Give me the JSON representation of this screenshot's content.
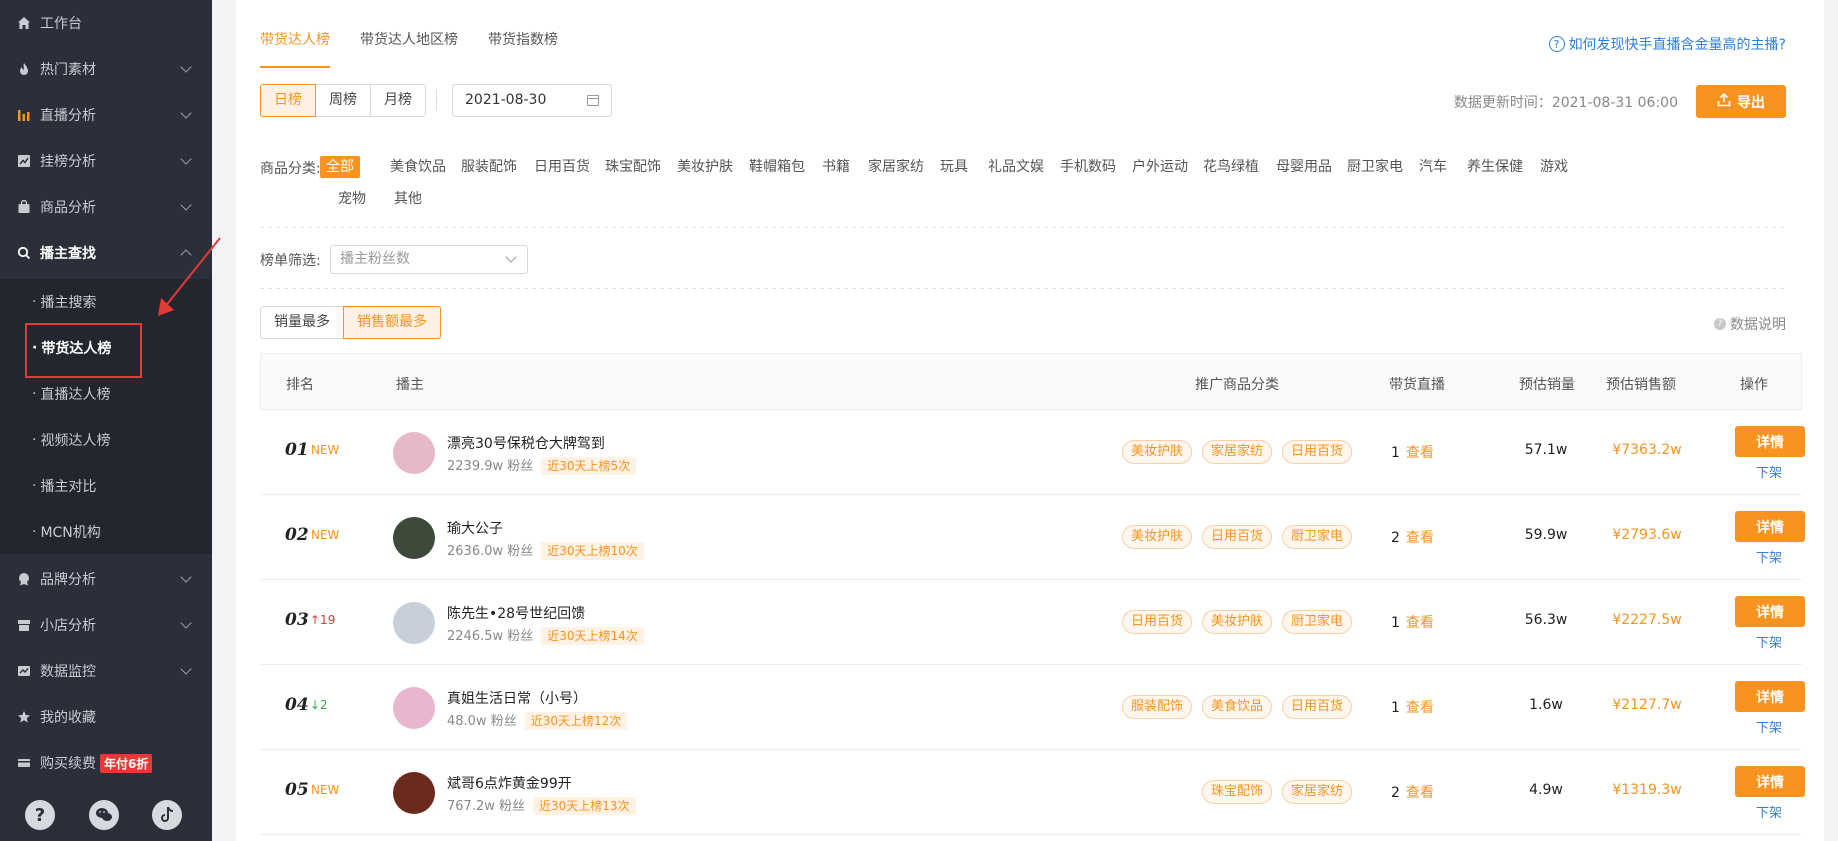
{
  "sidebar": {
    "items": [
      {
        "label": "工作台",
        "icon": "home-icon"
      },
      {
        "label": "热门素材",
        "icon": "flame-icon"
      },
      {
        "label": "直播分析",
        "icon": "bar-chart-icon"
      },
      {
        "label": "挂榜分析",
        "icon": "trend-icon"
      },
      {
        "label": "商品分析",
        "icon": "bag-icon"
      },
      {
        "label": "播主查找",
        "icon": "search-icon"
      }
    ],
    "subitems": [
      {
        "label": "播主搜索"
      },
      {
        "label": "带货达人榜"
      },
      {
        "label": "直播达人榜"
      },
      {
        "label": "视频达人榜"
      },
      {
        "label": "播主对比"
      },
      {
        "label": "MCN机构"
      }
    ],
    "lower_items": [
      {
        "label": "品牌分析",
        "icon": "brand-icon"
      },
      {
        "label": "小店分析",
        "icon": "store-icon"
      },
      {
        "label": "数据监控",
        "icon": "monitor-icon"
      },
      {
        "label": "我的收藏",
        "icon": "star-icon"
      },
      {
        "label": "购买续费",
        "icon": "card-icon",
        "badge": "年付6折"
      }
    ],
    "sub_dot": "·"
  },
  "tabs": [
    "带货达人榜",
    "带货达人地区榜",
    "带货指数榜"
  ],
  "help_link": "如何发现快手直播含金量高的主播?",
  "period": [
    "日榜",
    "周榜",
    "月榜"
  ],
  "date": "2021-08-30",
  "update_time": "数据更新时间：2021-08-31 06:00",
  "export_label": "导出",
  "category": {
    "label": "商品分类:",
    "items": [
      "全部",
      "美食饮品",
      "服装配饰",
      "日用百货",
      "珠宝配饰",
      "美妆护肤",
      "鞋帽箱包",
      "书籍",
      "家居家纺",
      "玩具",
      "礼品文娱",
      "手机数码",
      "户外运动",
      "花鸟绿植",
      "母婴用品",
      "厨卫家电",
      "汽车",
      "养生保健",
      "游戏",
      "宠物",
      "其他"
    ]
  },
  "filter": {
    "label": "榜单筛选:",
    "placeholder": "播主粉丝数"
  },
  "sort": [
    "销量最多",
    "销售额最多"
  ],
  "data_note": "数据说明",
  "table": {
    "headers": [
      "排名",
      "播主",
      "推广商品分类",
      "带货直播",
      "预估销量",
      "预估销售额",
      "操作"
    ],
    "view_label": "查看",
    "detail_label": "详情",
    "unlist_label": "下架",
    "rows": [
      {
        "rank": "01",
        "tag": "NEW",
        "tag_type": "new",
        "name": "漂亮30号保税仓大牌驾到",
        "fans": "2239.9w 粉丝",
        "pill": "近30天上榜5次",
        "cats": [
          "美妆护肤",
          "家居家纺",
          "日用百货"
        ],
        "live": "1",
        "sales": "57.1w",
        "amount": "¥7363.2w",
        "avatar": "#e6b8c9"
      },
      {
        "rank": "02",
        "tag": "NEW",
        "tag_type": "new",
        "name": "瑜大公子",
        "fans": "2636.0w 粉丝",
        "pill": "近30天上榜10次",
        "cats": [
          "美妆护肤",
          "日用百货",
          "厨卫家电"
        ],
        "live": "2",
        "sales": "59.9w",
        "amount": "¥2793.6w",
        "avatar": "#3d4a3a"
      },
      {
        "rank": "03",
        "tag": "↑19",
        "tag_type": "upc",
        "name": "陈先生•28号世纪回馈",
        "fans": "2246.5w 粉丝",
        "pill": "近30天上榜14次",
        "cats": [
          "日用百货",
          "美妆护肤",
          "厨卫家电"
        ],
        "live": "1",
        "sales": "56.3w",
        "amount": "¥2227.5w",
        "avatar": "#c9cfd8"
      },
      {
        "rank": "04",
        "tag": "↓2",
        "tag_type": "downc",
        "name": "真姐生活日常（小号）",
        "fans": "48.0w 粉丝",
        "pill": "近30天上榜12次",
        "cats": [
          "服装配饰",
          "美食饮品",
          "日用百货"
        ],
        "live": "1",
        "sales": "1.6w",
        "amount": "¥2127.7w",
        "avatar": "#e8b6cf"
      },
      {
        "rank": "05",
        "tag": "NEW",
        "tag_type": "new",
        "name": "斌哥6点炸黄金99开",
        "fans": "767.2w 粉丝",
        "pill": "近30天上榜13次",
        "cats": [
          "珠宝配饰",
          "家居家纺"
        ],
        "live": "2",
        "sales": "4.9w",
        "amount": "¥1319.3w",
        "avatar": "#6b2a1e"
      }
    ]
  },
  "colors": {
    "accent": "#f7931e",
    "link": "#2f7fe0",
    "sidebar_bg": "#2b2f3a"
  }
}
